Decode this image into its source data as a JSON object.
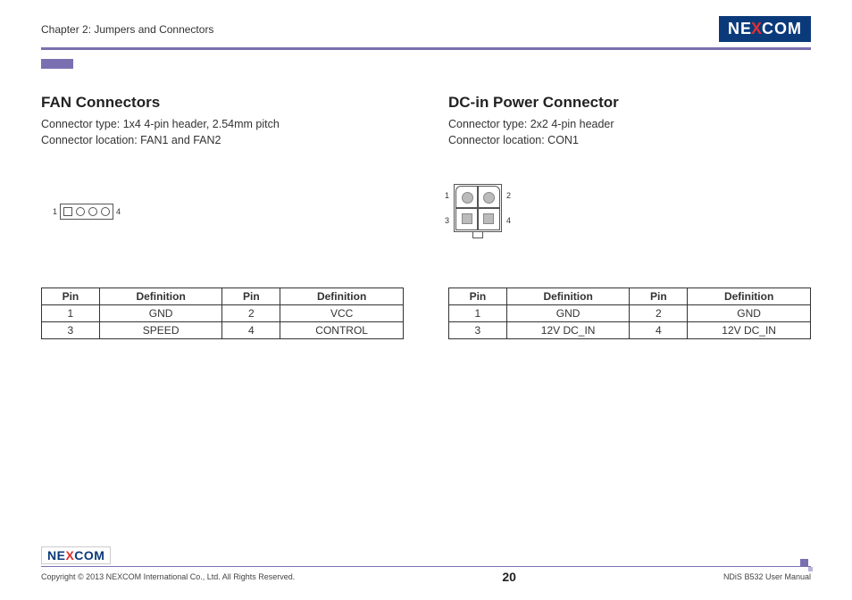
{
  "header": {
    "chapter": "Chapter 2: Jumpers and Connectors",
    "brand_pre": "NE",
    "brand_x": "X",
    "brand_post": "COM"
  },
  "left": {
    "title": "FAN Connectors",
    "line1": "Connector type: 1x4 4-pin header, 2.54mm pitch",
    "line2": "Connector location: FAN1 and FAN2",
    "diag_left": "1",
    "diag_right": "4",
    "th_pin": "Pin",
    "th_def": "Definition",
    "r1c1": "1",
    "r1c2": "GND",
    "r1c3": "2",
    "r1c4": "VCC",
    "r2c1": "3",
    "r2c2": "SPEED",
    "r2c3": "4",
    "r2c4": "CONTROL"
  },
  "right": {
    "title": "DC-in Power Connector",
    "line1": "Connector type: 2x2 4-pin header",
    "line2": "Connector location: CON1",
    "n1": "1",
    "n2": "2",
    "n3": "3",
    "n4": "4",
    "th_pin": "Pin",
    "th_def": "Definition",
    "r1c1": "1",
    "r1c2": "GND",
    "r1c3": "2",
    "r1c4": "GND",
    "r2c1": "3",
    "r2c2": "12V DC_IN",
    "r2c3": "4",
    "r2c4": "12V DC_IN"
  },
  "footer": {
    "copyright": "Copyright © 2013 NEXCOM International Co., Ltd. All Rights Reserved.",
    "page": "20",
    "doc": "NDiS B532 User Manual"
  }
}
